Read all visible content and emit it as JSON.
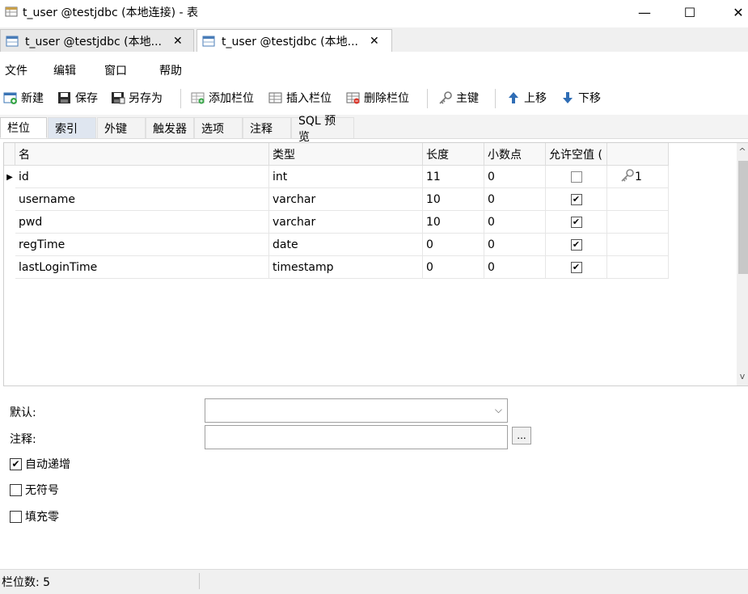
{
  "window": {
    "title": "t_user @testjdbc (本地连接) - 表",
    "minimize": "—",
    "maximize": "☐",
    "close": "✕"
  },
  "doc_tabs": [
    {
      "label": "t_user @testjdbc (本地...",
      "close": "✕"
    },
    {
      "label": "t_user @testjdbc (本地...",
      "close": "✕"
    }
  ],
  "menu": [
    "文件",
    "编辑",
    "窗口",
    "帮助"
  ],
  "toolbar": {
    "new": "新建",
    "save": "保存",
    "save_as": "另存为",
    "add_column": "添加栏位",
    "insert_column": "插入栏位",
    "delete_column": "删除栏位",
    "primary_key": "主键",
    "move_up": "上移",
    "move_down": "下移"
  },
  "sub_tabs": [
    "栏位",
    "索引",
    "外键",
    "触发器",
    "选项",
    "注释",
    "SQL 预览"
  ],
  "grid": {
    "headers": [
      "名",
      "类型",
      "长度",
      "小数点",
      "允许空值 ("
    ],
    "rows": [
      {
        "name": "id",
        "type": "int",
        "length": "11",
        "decimals": "0",
        "nullable": false,
        "key": "1"
      },
      {
        "name": "username",
        "type": "varchar",
        "length": "10",
        "decimals": "0",
        "nullable": true,
        "key": ""
      },
      {
        "name": "pwd",
        "type": "varchar",
        "length": "10",
        "decimals": "0",
        "nullable": true,
        "key": ""
      },
      {
        "name": "regTime",
        "type": "date",
        "length": "0",
        "decimals": "0",
        "nullable": true,
        "key": ""
      },
      {
        "name": "lastLoginTime",
        "type": "timestamp",
        "length": "0",
        "decimals": "0",
        "nullable": true,
        "key": ""
      }
    ]
  },
  "properties": {
    "default_label": "默认:",
    "comment_label": "注释:",
    "ellipsis": "...",
    "auto_increment": {
      "label": "自动递增",
      "checked": true
    },
    "unsigned": {
      "label": "无符号",
      "checked": false
    },
    "zerofill": {
      "label": "填充零",
      "checked": false
    }
  },
  "status": "栏位数: 5",
  "colors": {
    "accent_blue": "#2f6db5",
    "tab_highlight": "#dfe6f0"
  }
}
